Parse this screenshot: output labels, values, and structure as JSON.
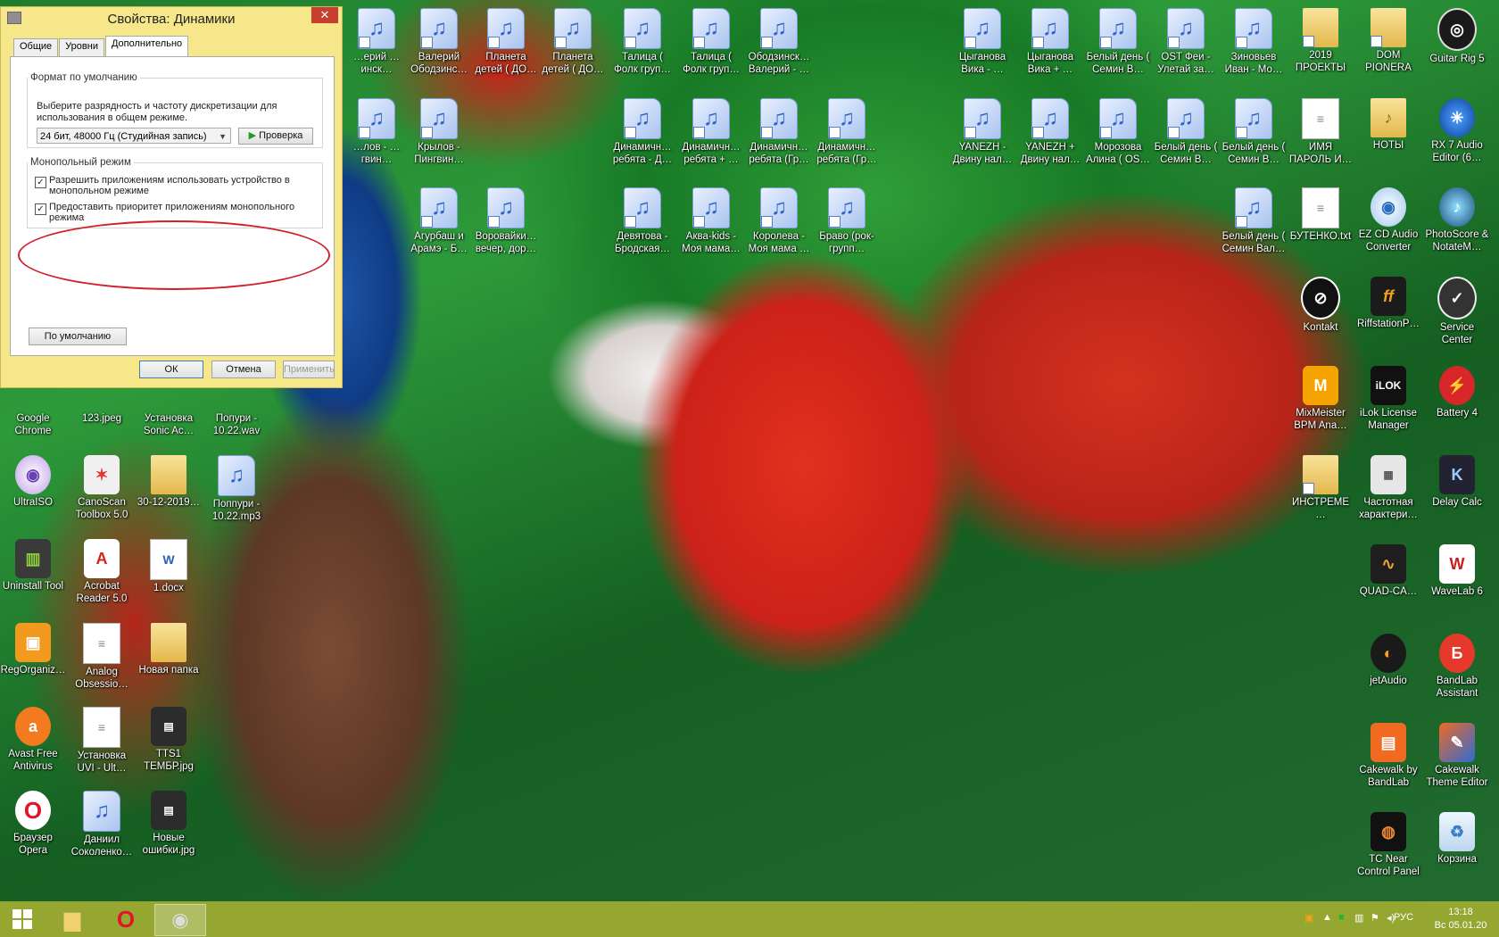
{
  "dialog": {
    "title": "Свойства: Динамики",
    "close_label": "✕",
    "tabs": [
      "Общие",
      "Уровни",
      "Дополнительно"
    ],
    "default_format": {
      "legend": "Формат по умолчанию",
      "description": "Выберите разрядность и частоту дискретизации для использования в общем режиме.",
      "selected": "24 бит, 48000 Гц (Студийная запись)",
      "test_label": "Проверка"
    },
    "exclusive": {
      "legend": "Монопольный режим",
      "allow_label": "Разрешить приложениям использовать устройство в монопольном режиме",
      "priority_label": "Предоставить приоритет приложениям монопольного режима"
    },
    "defaults_label": "По умолчанию",
    "ok_label": "ОК",
    "cancel_label": "Отмена",
    "apply_label": "Применить"
  },
  "icons": [
    {
      "label": "…ерий …инск…",
      "kind": "audio"
    },
    {
      "label": "Валерий Ободзинс…",
      "kind": "audio"
    },
    {
      "label": "Планета детей ( ДО…",
      "kind": "audio"
    },
    {
      "label": "Планета детей ( ДО…",
      "kind": "audio"
    },
    {
      "label": "Талица ( Фолк груп…",
      "kind": "audio"
    },
    {
      "label": "Талица ( Фолк груп…",
      "kind": "audio"
    },
    {
      "label": "Ободзинск… Валерий - …",
      "kind": "audio"
    },
    {
      "label": "Цыганова Вика - …",
      "kind": "audio"
    },
    {
      "label": "Цыганова Вика + …",
      "kind": "audio"
    },
    {
      "label": "Белый день ( Семин В…",
      "kind": "audio"
    },
    {
      "label": "OST Феи - Улетай за…",
      "kind": "audio"
    },
    {
      "label": "Зиновьев Иван - Мо…",
      "kind": "audio"
    },
    {
      "label": "2019 ПРОЕКТЫ",
      "kind": "folder"
    },
    {
      "label": "DOM PIONERA",
      "kind": "folder"
    },
    {
      "label": "Guitar Rig 5",
      "kind": "app"
    },
    {
      "label": "…лов - …гвин…",
      "kind": "audio"
    },
    {
      "label": "Крылов - Пингвин…",
      "kind": "audio"
    },
    {
      "label": "Динамичн… ребята - Д…",
      "kind": "audio"
    },
    {
      "label": "Динамичн… ребята + …",
      "kind": "audio"
    },
    {
      "label": "Динамичн… ребята (Гр…",
      "kind": "audio"
    },
    {
      "label": "Динамичн… ребята (Гр…",
      "kind": "audio"
    },
    {
      "label": "YANEZH - Двину нал…",
      "kind": "audio"
    },
    {
      "label": "YANEZH + Двину нал…",
      "kind": "audio"
    },
    {
      "label": "Морозова Алина ( OS…",
      "kind": "audio"
    },
    {
      "label": "Белый день ( Семин В…",
      "kind": "audio"
    },
    {
      "label": "Белый день ( Семин В…",
      "kind": "audio"
    },
    {
      "label": "ИМЯ ПАРОЛЬ И…",
      "kind": "text"
    },
    {
      "label": "НОТЫ",
      "kind": "folder"
    },
    {
      "label": "RX 7 Audio Editor (6…",
      "kind": "app"
    },
    {
      "label": "Агурбаш и Арамэ - Б…",
      "kind": "audio"
    },
    {
      "label": "Воровайки… вечер, дор…",
      "kind": "audio"
    },
    {
      "label": "Девятова - Бродская…",
      "kind": "audio"
    },
    {
      "label": "Аква-kids - Моя мама…",
      "kind": "audio"
    },
    {
      "label": "Королева - Моя мама …",
      "kind": "audio"
    },
    {
      "label": "Браво (рок-групп…",
      "kind": "audio"
    },
    {
      "label": "Белый день ( Семин Вал…",
      "kind": "audio"
    },
    {
      "label": "БУТЕНКО.txt",
      "kind": "text"
    },
    {
      "label": "EZ CD Audio Converter",
      "kind": "app"
    },
    {
      "label": "PhotoScore & NotateM…",
      "kind": "app"
    },
    {
      "label": "Kontakt",
      "kind": "app"
    },
    {
      "label": "RiffstationP…",
      "kind": "app"
    },
    {
      "label": "Service Center",
      "kind": "app"
    },
    {
      "label": "MixMeister BPM Ana…",
      "kind": "app"
    },
    {
      "label": "iLok License Manager",
      "kind": "app"
    },
    {
      "label": "Battery 4",
      "kind": "app"
    },
    {
      "label": "ИНСТРЕМЕ…",
      "kind": "folder"
    },
    {
      "label": "Частотная характери…",
      "kind": "app"
    },
    {
      "label": "Delay Calc",
      "kind": "app"
    },
    {
      "label": "QUAD-CA…",
      "kind": "app"
    },
    {
      "label": "WaveLab 6",
      "kind": "app"
    },
    {
      "label": "jetAudio",
      "kind": "app"
    },
    {
      "label": "BandLab Assistant",
      "kind": "app"
    },
    {
      "label": "Cakewalk by BandLab",
      "kind": "app"
    },
    {
      "label": "Cakewalk Theme Editor",
      "kind": "app"
    },
    {
      "label": "TC Near Control Panel",
      "kind": "app"
    },
    {
      "label": "Корзина",
      "kind": "app"
    },
    {
      "label": "Google Chrome",
      "kind": "app"
    },
    {
      "label": "123.jpeg",
      "kind": "app"
    },
    {
      "label": "Установка Sonic Ac…",
      "kind": "text"
    },
    {
      "label": "Попури - 10.22.wav",
      "kind": "audio"
    },
    {
      "label": "UltraISO",
      "kind": "app"
    },
    {
      "label": "CanoScan Toolbox 5.0",
      "kind": "app"
    },
    {
      "label": "30-12-2019…",
      "kind": "folder"
    },
    {
      "label": "Поппури - 10.22.mp3",
      "kind": "audio"
    },
    {
      "label": "Uninstall Tool",
      "kind": "app"
    },
    {
      "label": "Acrobat Reader 5.0",
      "kind": "app"
    },
    {
      "label": "1.docx",
      "kind": "text"
    },
    {
      "label": "RegOrganiz…",
      "kind": "app"
    },
    {
      "label": "Analog Obsessio…",
      "kind": "text"
    },
    {
      "label": "Новая папка",
      "kind": "folder"
    },
    {
      "label": "Avast Free Antivirus",
      "kind": "app"
    },
    {
      "label": "Установка UVI - Ult…",
      "kind": "text"
    },
    {
      "label": "TTS1 ТЕМБР.jpg",
      "kind": "app"
    },
    {
      "label": "Браузер Opera",
      "kind": "app"
    },
    {
      "label": "Даниил Соколенко…",
      "kind": "audio"
    },
    {
      "label": "Новые ошибки.jpg",
      "kind": "app"
    }
  ],
  "taskbar": {
    "lang": "РУС",
    "time": "13:18",
    "date": "Вс 05.01.20"
  }
}
